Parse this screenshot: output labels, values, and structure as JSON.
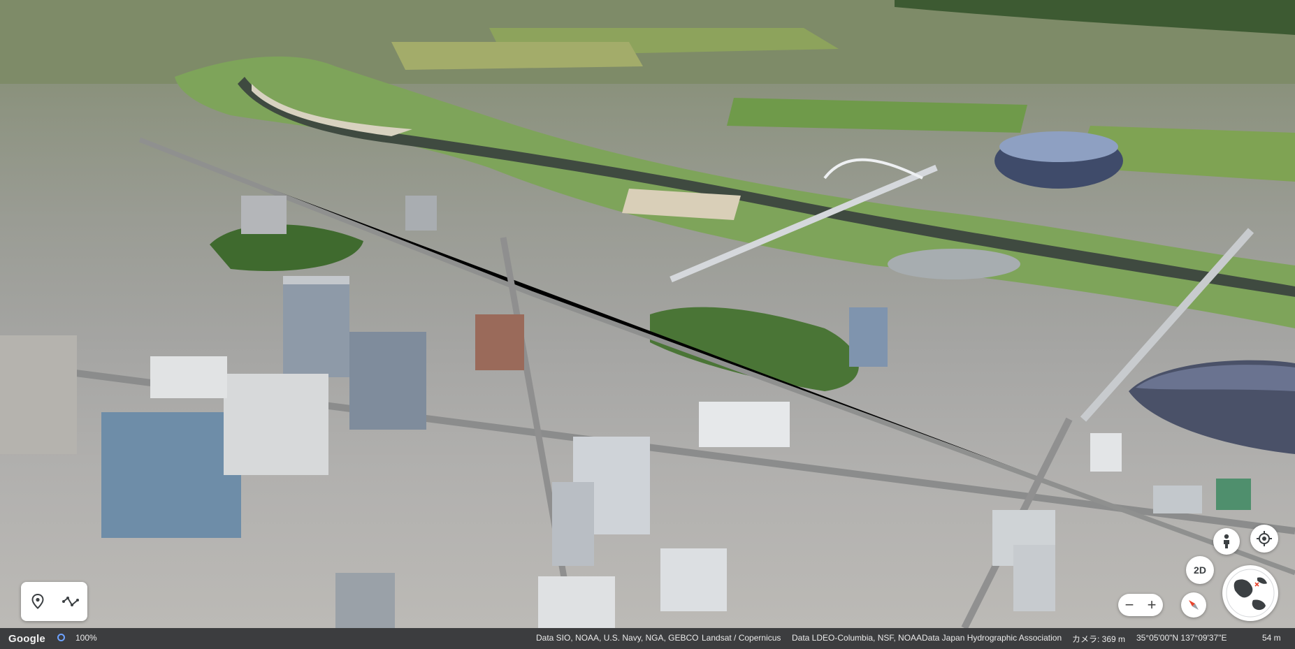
{
  "map": {
    "logo": "Google",
    "loading_percent": "100%",
    "attributions": [
      "Data SIO, NOAA, U.S. Navy, NGA, GEBCO",
      "Landsat / Copernicus",
      "Data LDEO-Columbia, NSF, NOAA",
      "Data Japan Hydrographic Association"
    ],
    "camera": "カメラ: 369 m",
    "coordinates": "35°05'00\"N 137°09'37\"E",
    "scale": "54 m"
  },
  "controls": {
    "view_2d_label": "2D",
    "zoom_out_label": "−",
    "zoom_in_label": "+",
    "icons": [
      "location-pin-icon",
      "path-icon",
      "pegman-icon",
      "my-location-icon",
      "compass-icon",
      "globe-icon"
    ]
  },
  "colors": {
    "footer_bg": "#3c3d3f",
    "loading_ring": "#6ea3ff",
    "compass_red": "#e8452e"
  }
}
